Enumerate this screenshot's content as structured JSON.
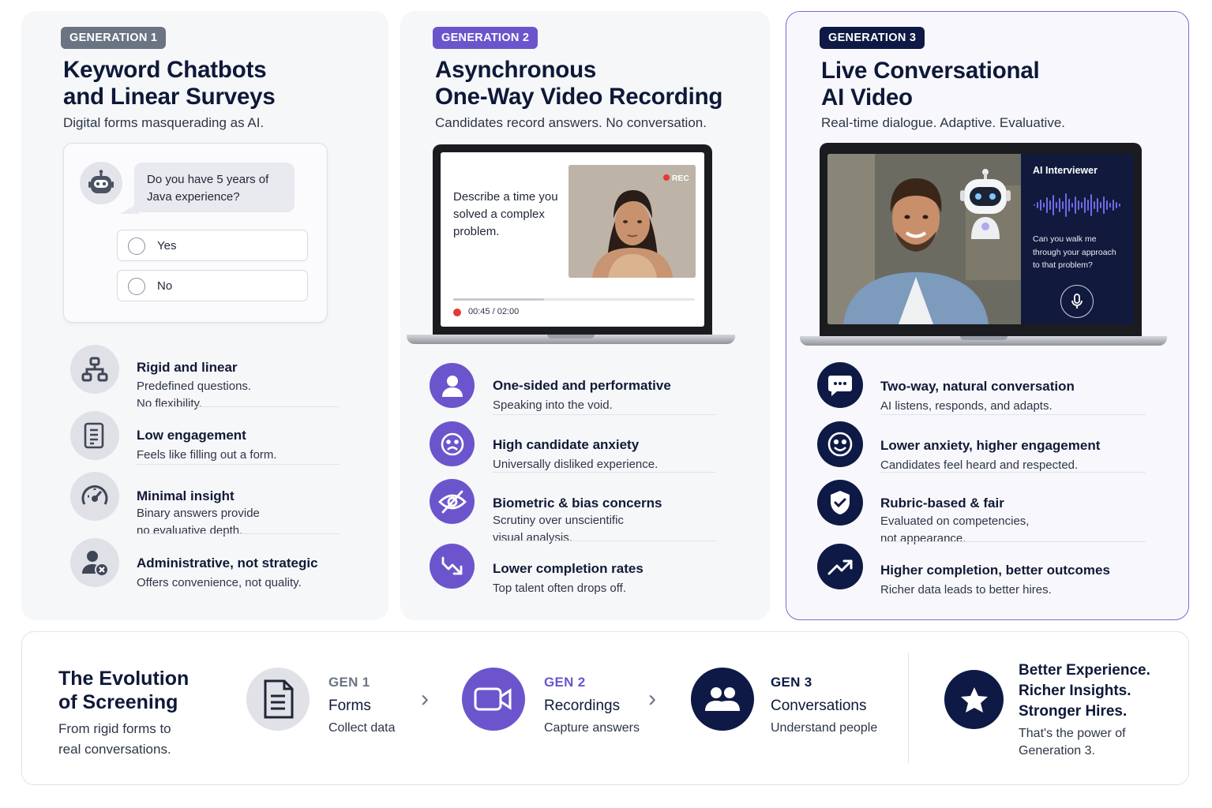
{
  "gen1": {
    "badge": "GENERATION 1",
    "title_line1": "Keyword Chatbots",
    "title_line2": "and Linear Surveys",
    "subtitle": "Digital forms masquerading as AI.",
    "chat": {
      "question_line1": "Do you have 5 years of",
      "question_line2": "Java experience?",
      "options": [
        "Yes",
        "No"
      ]
    },
    "features": [
      {
        "icon": "hierarchy-icon",
        "title": "Rigid and linear",
        "desc1": "Predefined questions.",
        "desc2": "No flexibility."
      },
      {
        "icon": "form-document-icon",
        "title": "Low engagement",
        "desc1": "Feels like filling out a form.",
        "desc2": ""
      },
      {
        "icon": "speedometer-icon",
        "title": "Minimal insight",
        "desc1": "Binary answers provide",
        "desc2": "no evaluative depth."
      },
      {
        "icon": "user-x-icon",
        "title": "Administrative, not strategic",
        "desc1": "Offers convenience, not quality.",
        "desc2": ""
      }
    ]
  },
  "gen2": {
    "badge": "GENERATION 2",
    "title_line1": "Asynchronous",
    "title_line2": "One-Way Video Recording",
    "subtitle": "Candidates record answers. No conversation.",
    "screen": {
      "prompt_line1": "Describe a time you",
      "prompt_line2": "solved a complex",
      "prompt_line3": "problem.",
      "rec_label": "REC",
      "time": "00:45 / 02:00",
      "progress": 0.375
    },
    "features": [
      {
        "icon": "user-icon",
        "title": "One-sided and performative",
        "desc1": "Speaking into the void.",
        "desc2": ""
      },
      {
        "icon": "sad-face-icon",
        "title": "High candidate anxiety",
        "desc1": "Universally disliked experience.",
        "desc2": ""
      },
      {
        "icon": "eye-off-icon",
        "title": "Biometric & bias concerns",
        "desc1": "Scrutiny over unscientific",
        "desc2": "visual analysis."
      },
      {
        "icon": "trend-down-icon",
        "title": "Lower completion rates",
        "desc1": "Top talent often drops off.",
        "desc2": ""
      }
    ]
  },
  "gen3": {
    "badge": "GENERATION 3",
    "title_line1": "Live Conversational",
    "title_line2": "AI Video",
    "subtitle": "Real-time dialogue. Adaptive. Evaluative.",
    "screen": {
      "panel_title": "AI Interviewer",
      "question_line1": "Can you walk me",
      "question_line2": "through your approach",
      "question_line3": "to that problem?"
    },
    "features": [
      {
        "icon": "chat-bubble-icon",
        "title": "Two-way, natural conversation",
        "desc1": "AI listens, responds, and adapts.",
        "desc2": ""
      },
      {
        "icon": "smile-face-icon",
        "title": "Lower anxiety, higher engagement",
        "desc1": "Candidates feel heard and respected.",
        "desc2": ""
      },
      {
        "icon": "shield-check-icon",
        "title": "Rubric-based & fair",
        "desc1": "Evaluated on competencies,",
        "desc2": "not appearance."
      },
      {
        "icon": "trend-up-icon",
        "title": "Higher completion, better outcomes",
        "desc1": "Richer data leads to better hires.",
        "desc2": ""
      }
    ]
  },
  "bottom": {
    "title_line1": "The Evolution",
    "title_line2": "of Screening",
    "sub_line1": "From rigid forms to",
    "sub_line2": "real conversations.",
    "steps": [
      {
        "gen": "GEN 1",
        "name": "Forms",
        "desc": "Collect data",
        "icon": "document-icon"
      },
      {
        "gen": "GEN 2",
        "name": "Recordings",
        "desc": "Capture answers",
        "icon": "video-camera-icon"
      },
      {
        "gen": "GEN 3",
        "name": "Conversations",
        "desc": "Understand people",
        "icon": "people-icon"
      }
    ],
    "closing_line1": "Better Experience.",
    "closing_line2": "Richer Insights.",
    "closing_line3": "Stronger Hires.",
    "closing_sub1": "That's the power of",
    "closing_sub2": "Generation 3."
  },
  "colors": {
    "gen1": "#6b7483",
    "gen2": "#6c55cc",
    "gen3": "#0e1a45",
    "rec": "#e53935"
  }
}
